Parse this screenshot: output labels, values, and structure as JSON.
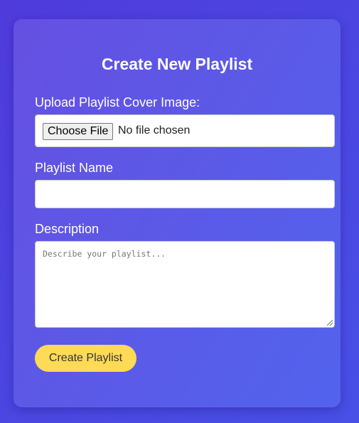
{
  "form": {
    "title": "Create New Playlist",
    "cover_label": "Upload Playlist Cover Image:",
    "file_button": "Choose File",
    "file_status": "No file chosen",
    "name_label": "Playlist Name",
    "name_value": "",
    "description_label": "Description",
    "description_placeholder": "Describe your playlist...",
    "submit_label": "Create Playlist"
  },
  "colors": {
    "accent": "#ffda55",
    "background": "#4f3bdc"
  }
}
